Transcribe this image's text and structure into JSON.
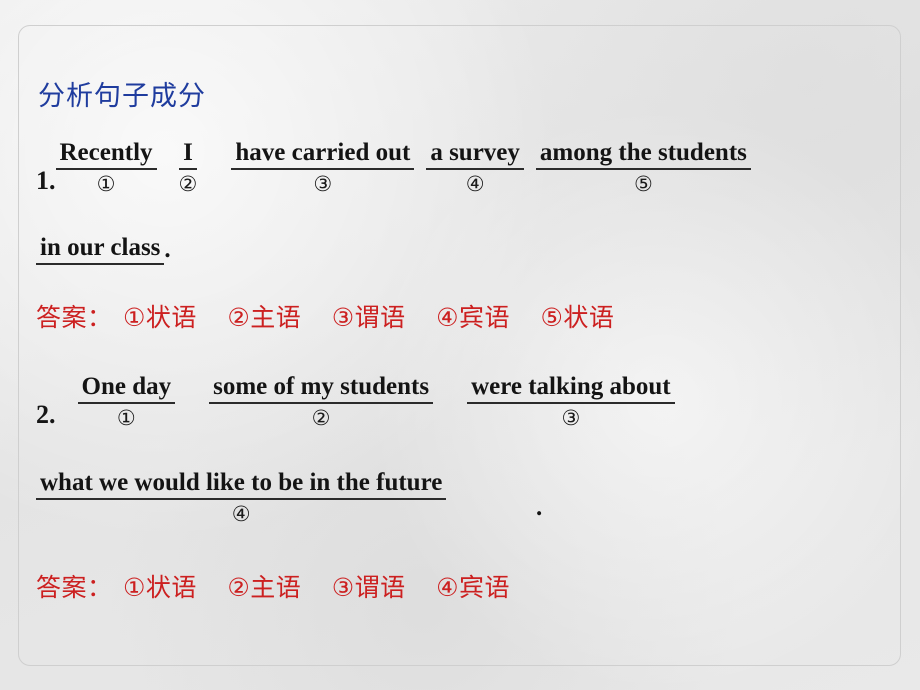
{
  "slide": {
    "heading": "分析句子成分",
    "colors": {
      "heading": "#1f3c9e",
      "answer": "#cc2020",
      "text": "#141414",
      "background": "#e8e8e8",
      "frame_border": "#cfcfcf"
    }
  },
  "questions": [
    {
      "number": "1.",
      "lines": [
        {
          "chunks": [
            {
              "phrase": "Recently",
              "marker": "①"
            },
            {
              "phrase": "I",
              "marker": "②"
            },
            {
              "phrase": "have carried out",
              "marker": "③"
            },
            {
              "phrase": "a survey",
              "marker": "④"
            },
            {
              "phrase": "among the students",
              "marker": "⑤"
            }
          ]
        },
        {
          "chunks": [
            {
              "phrase": "in our class",
              "marker": ""
            }
          ],
          "trailing": "."
        }
      ],
      "answer": {
        "label": "答案：",
        "items": [
          "①状语",
          "②主语",
          "③谓语",
          "④宾语",
          "⑤状语"
        ]
      }
    },
    {
      "number": "2.",
      "lines": [
        {
          "chunks": [
            {
              "phrase": "One day",
              "marker": "①"
            },
            {
              "phrase": "some of my students",
              "marker": "②"
            },
            {
              "phrase": "were talking about",
              "marker": "③"
            }
          ]
        },
        {
          "chunks": [
            {
              "phrase": "what we would like to be in the future",
              "marker": "④"
            }
          ],
          "trailing": "."
        }
      ],
      "answer": {
        "label": "答案：",
        "items": [
          "①状语",
          "②主语",
          "③谓语",
          "④宾语"
        ]
      }
    }
  ]
}
